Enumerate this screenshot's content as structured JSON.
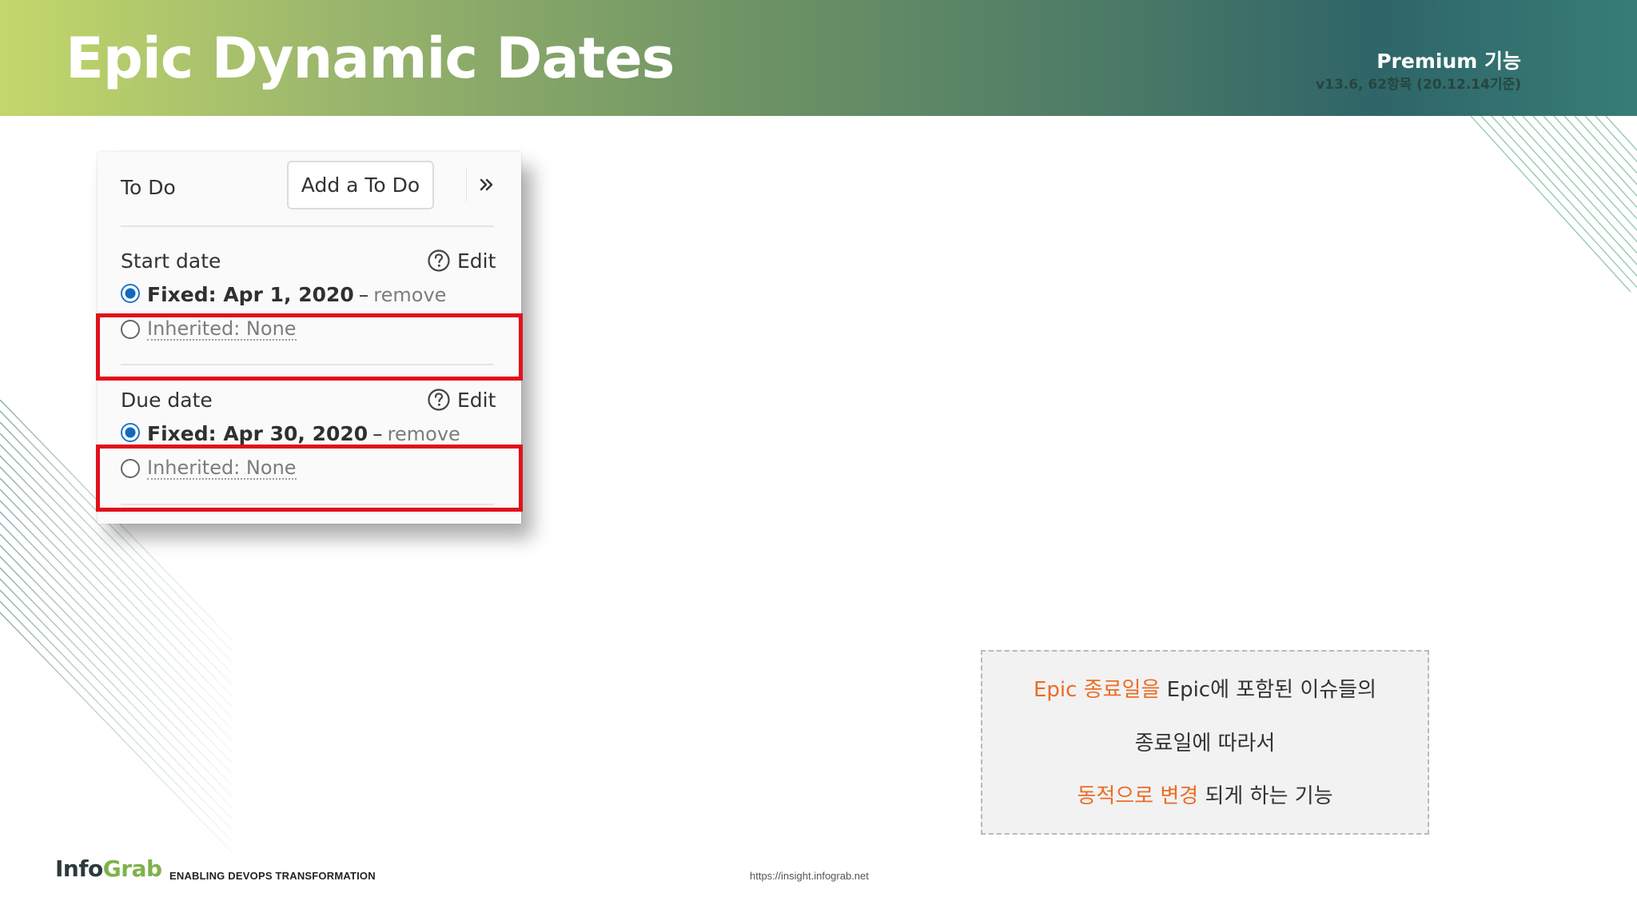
{
  "header": {
    "title": "Epic Dynamic Dates",
    "badge": "Premium 기능",
    "version": "v13.6, 62항목 (20.12.14기준)"
  },
  "sidebar": {
    "todo_label": "To Do",
    "add_todo_label": "Add a To Do",
    "expand_icon": "chevron-double-right-icon",
    "start_date": {
      "label": "Start date",
      "edit_label": "Edit",
      "fixed_text": "Fixed: Apr 1, 2020",
      "separator": "–",
      "remove_label": "remove",
      "fixed_selected": true,
      "inherited_text": "Inherited: None",
      "inherited_selected": false
    },
    "due_date": {
      "label": "Due date",
      "edit_label": "Edit",
      "fixed_text": "Fixed: Apr 30, 2020",
      "separator": "–",
      "remove_label": "remove",
      "fixed_selected": true,
      "inherited_text": "Inherited: None",
      "inherited_selected": false
    },
    "help_icon": "question-circle-icon"
  },
  "description": {
    "line1_accent": "Epic 종료일을",
    "line1_rest": " Epic에 포함된 이슈들의",
    "line2": "종료일에 따라서",
    "line3_accent": "동적으로 변경",
    "line3_rest": " 되게 하는 기능"
  },
  "footer": {
    "logo_info": "Info",
    "logo_grab": "Grab",
    "tagline": "ENABLING DEVOPS TRANSFORMATION",
    "url": "https://insight.infograb.net"
  },
  "colors": {
    "accent_orange": "#ec6c26",
    "highlight_red": "#e0101a",
    "radio_blue": "#1068bf",
    "banner_start": "#c3d76b",
    "banner_end": "#377d77"
  }
}
